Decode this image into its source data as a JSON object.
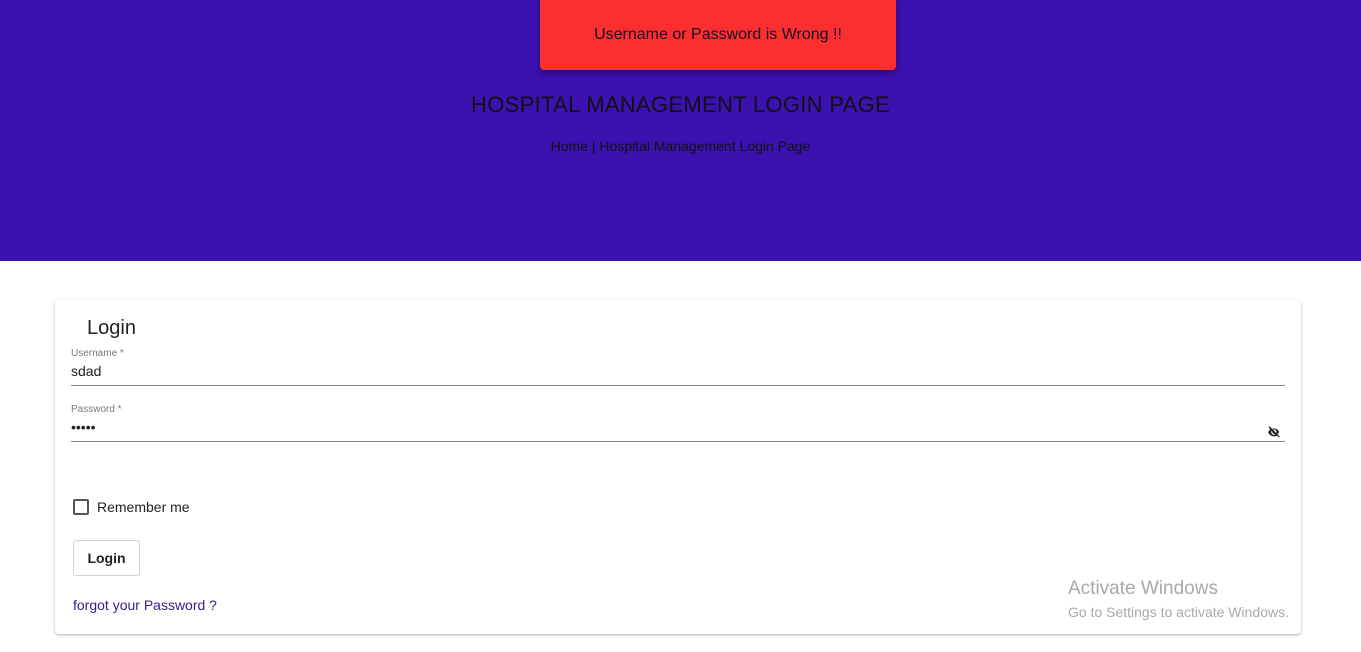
{
  "colors": {
    "hero_bg": "#3b11b0",
    "toast_bg": "#fb2f2f",
    "link": "#3b1a8a"
  },
  "toast": {
    "message": "Username or Password is Wrong !!"
  },
  "header": {
    "title": "HOSPITAL MANAGEMENT LOGIN PAGE",
    "breadcrumb": {
      "home": "Home",
      "separator": " | ",
      "current": "Hospital Management Login Page"
    }
  },
  "login_form": {
    "title": "Login",
    "username": {
      "label": "Username *",
      "value": "sdad"
    },
    "password": {
      "label": "Password *",
      "value": "•••••",
      "toggle_icon": "eye-off-icon"
    },
    "remember_me": {
      "label": "Remember me",
      "checked": false
    },
    "submit_label": "Login",
    "forgot_link": "forgot your Password ?"
  },
  "watermark": {
    "line1": "Activate Windows",
    "line2": "Go to Settings to activate Windows."
  }
}
